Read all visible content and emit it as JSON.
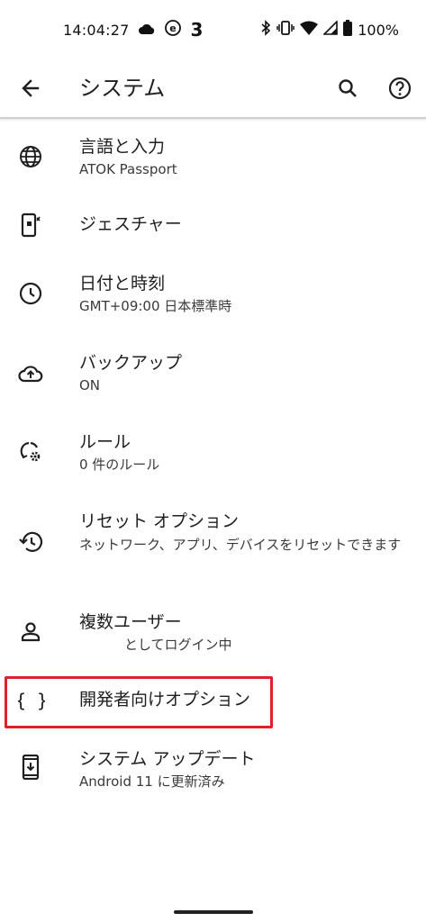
{
  "status_bar": {
    "time": "14:04:27",
    "carrier_mark": "3",
    "battery": "100%",
    "icons_left": [
      "cloud-icon",
      "e-badge-icon"
    ],
    "icons_right": [
      "bluetooth-icon",
      "vibrate-icon",
      "wifi-icon",
      "signal-icon",
      "battery-icon"
    ]
  },
  "app_bar": {
    "title": "システム",
    "back_icon": "arrow-back-icon",
    "search_icon": "search-icon",
    "help_icon": "help-icon"
  },
  "items": [
    {
      "label": "言語と入力",
      "summary": "ATOK Passport",
      "icon": "globe-icon"
    },
    {
      "label": "ジェスチャー",
      "summary": "",
      "icon": "gesture-phone-icon"
    },
    {
      "label": "日付と時刻",
      "summary": "GMT+09:00 日本標準時",
      "icon": "clock-icon"
    },
    {
      "label": "バックアップ",
      "summary": "ON",
      "icon": "cloud-upload-icon"
    },
    {
      "label": "ルール",
      "summary": "0 件のルール",
      "icon": "rules-icon"
    },
    {
      "label": "リセット オプション",
      "summary": "ネットワーク、アプリ、デバイスをリセットできます",
      "icon": "history-icon"
    },
    {
      "label": "複数ユーザー",
      "summary": "としてログイン中",
      "icon": "person-icon"
    },
    {
      "label": "開発者向けオプション",
      "summary": "",
      "icon": "braces-icon"
    },
    {
      "label": "システム アップデート",
      "summary": "Android 11 に更新済み",
      "icon": "system-update-icon"
    }
  ],
  "colors": {
    "highlight": "#e0202a",
    "text_primary": "#1f1f1f",
    "text_secondary": "#3a3a3a"
  }
}
